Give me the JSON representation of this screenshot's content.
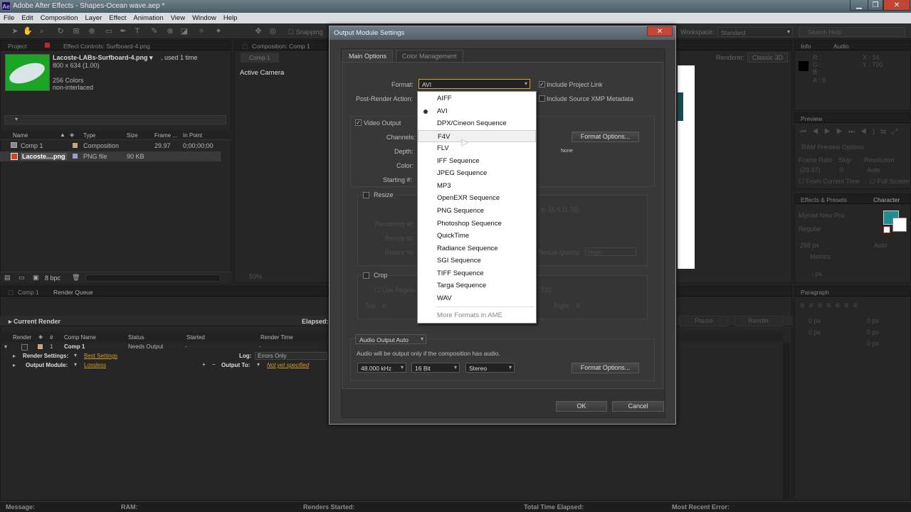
{
  "window": {
    "title": "Adobe After Effects - Shapes-Ocean wave.aep *",
    "app_icon_text": "Ae",
    "controls": {
      "minimize": "▁",
      "maximize": "❐",
      "close": "✕"
    }
  },
  "menu": [
    "File",
    "Edit",
    "Composition",
    "Layer",
    "Effect",
    "Animation",
    "View",
    "Window",
    "Help"
  ],
  "toolbar": {
    "snapping": "Snapping",
    "workspace_label": "Workspace:",
    "workspace_value": "Standard",
    "search_placeholder": "Search Help"
  },
  "project_panel": {
    "tabs": [
      "Project",
      "Effect Controls: Surfboard-4.png"
    ],
    "selected_name": "Lacoste-LABs-Surfboard-4.png ▾",
    "used": ", used 1 time",
    "dims": "800 x 634 (1.00)",
    "colors": "256 Colors",
    "interlace": "non-interlaced",
    "search_placeholder": "",
    "columns": [
      "Name",
      "Type",
      "Size",
      "Frame ...",
      "In Point"
    ],
    "items": [
      {
        "name": "Comp 1",
        "type": "Composition",
        "size": "",
        "fps": "29.97",
        "in": "0;00;00;00"
      },
      {
        "name": "Lacoste....png",
        "type": "PNG file",
        "size": "90 KB",
        "fps": "",
        "in": ""
      }
    ],
    "bpc": "8 bpc"
  },
  "comp_panel": {
    "tab": "Composition: Comp 1",
    "subtab": "Comp 1",
    "camera": "Active Camera",
    "renderer_label": "Renderer:",
    "renderer_value": "Classic 3D",
    "zoom": "50%"
  },
  "render_queue": {
    "tabs": [
      "Comp 1",
      "Render Queue"
    ],
    "current_render": "Current Render",
    "elapsed": "Elapsed:",
    "pause": "Pause",
    "render": "Render",
    "columns": [
      "Render",
      "#",
      "Comp Name",
      "Status",
      "Started",
      "Render Time"
    ],
    "row": {
      "num": "1",
      "comp": "Comp 1",
      "status": "Needs Output",
      "started": "-",
      "time": "-"
    },
    "render_settings_label": "Render Settings:",
    "render_settings_value": "Best Settings",
    "log_label": "Log:",
    "log_value": "Errors Only",
    "output_module_label": "Output Module:",
    "output_module_value": "Lossless",
    "output_to_label": "Output To:",
    "output_to_value": "Not yet specified"
  },
  "right_panels": {
    "info_tabs": [
      "Info",
      "Audio"
    ],
    "info_values": {
      "r": "R :",
      "g": "G :",
      "b": "B :",
      "a": "A : 0",
      "x": "X : 34",
      "y": "Y : 700"
    },
    "preview_tab": "Preview",
    "ram_preview": "RAM Preview Options",
    "frame_rate": "Frame Rate",
    "skip": "Skip",
    "resolution": "Resolution",
    "fps_value": "(29.97)",
    "skip_value": "0",
    "res_value": "Auto",
    "from_current": "From Current Time",
    "full_screen": "Full Screen",
    "effects_tab": "Effects & Presets",
    "character_tab": "Character",
    "font_value": "Myriad New Pro",
    "style_value": "Regular",
    "size_value": "288 px",
    "auto": "Auto",
    "metrics": "Metrics",
    "px": "- px",
    "paragraph_tab": "Paragraph",
    "para_vals": [
      "0 px",
      "0 px",
      "0 px",
      "0 px",
      "0 px"
    ]
  },
  "dialog": {
    "title": "Output Module Settings",
    "close": "✕",
    "tabs": [
      "Main Options",
      "Color Management"
    ],
    "format_label": "Format:",
    "format_value": "AVI",
    "include_project_link": "Include Project Link",
    "post_render_label": "Post-Render Action:",
    "include_xmp": "Include Source XMP Metadata",
    "video_output": "Video Output",
    "channels_label": "Channels:",
    "depth_label": "Depth:",
    "color_label": "Color:",
    "starting_label": "Starting #:",
    "format_options": "Format Options...",
    "none": "None",
    "resize": "Resize",
    "rendering_at": "Rendering at:",
    "resize_to": "Resize to:",
    "resize_pct": "Resize %:",
    "ratio": "to 16:9 (1.78)",
    "resize_quality": "Resize Quality:",
    "quality_value": "High",
    "crop": "Crop",
    "use_region": "Use Region",
    "top": "Top:",
    "top_val": "0",
    "right": "Right:",
    "right_val": "0",
    "crop_val": "720",
    "audio_output": "Audio Output Auto",
    "audio_note": "Audio will be output only if the composition has audio.",
    "sample_rate": "48.000 kHz",
    "bit_depth": "16 Bit",
    "channels_audio": "Stereo",
    "audio_format_options": "Format Options...",
    "ok": "OK",
    "cancel": "Cancel"
  },
  "format_menu": {
    "items": [
      "AIFF",
      "AVI",
      "DPX/Cineon Sequence",
      "F4V",
      "FLV",
      "IFF Sequence",
      "JPEG Sequence",
      "MP3",
      "OpenEXR Sequence",
      "PNG Sequence",
      "Photoshop Sequence",
      "QuickTime",
      "Radiance Sequence",
      "SGI Sequence",
      "TIFF Sequence",
      "Targa Sequence",
      "WAV"
    ],
    "more": "More Formats in AME",
    "selected": "AVI",
    "hovered": "F4V"
  },
  "status_bar": {
    "message": "Message:",
    "ram": "RAM:",
    "renders_started": "Renders Started:",
    "total_time": "Total Time Elapsed:",
    "recent_error": "Most Recent Error:"
  },
  "colors": {
    "accent_teal": "#1f8c8f",
    "titlebar": "#5a6d76",
    "close_red": "#c6463b"
  }
}
